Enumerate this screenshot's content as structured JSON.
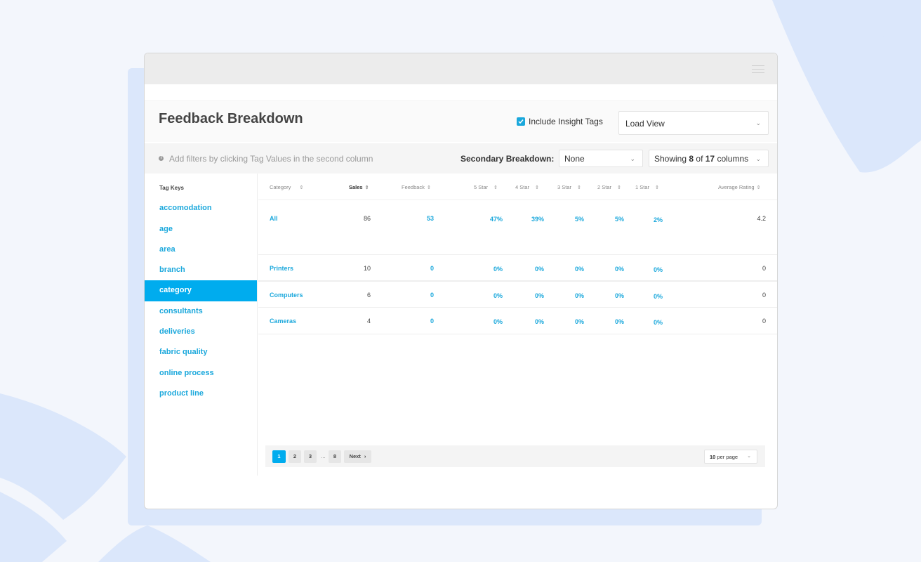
{
  "header": {
    "title": "Feedback Breakdown",
    "include_insight_label": "Include Insight Tags",
    "include_insight_checked": true,
    "load_view": "Load View"
  },
  "filters": {
    "hint": "Add filters by clicking Tag Values in the second column",
    "secondary_label": "Secondary Breakdown:",
    "secondary_value": "None",
    "showing_prefix": "Showing ",
    "showing_count": "8",
    "showing_mid": " of ",
    "showing_total": "17",
    "showing_suffix": " columns"
  },
  "sidebar": {
    "title": "Tag Keys",
    "items": [
      {
        "label": "accomodation"
      },
      {
        "label": "age"
      },
      {
        "label": "area"
      },
      {
        "label": "branch"
      },
      {
        "label": "category"
      },
      {
        "label": "consultants"
      },
      {
        "label": "deliveries"
      },
      {
        "label": "fabric quality"
      },
      {
        "label": "online process"
      },
      {
        "label": "product line"
      }
    ],
    "active_item": "category"
  },
  "table": {
    "columns": [
      "Category",
      "Sales",
      "Feedback",
      "5 Star",
      "4 Star",
      "3 Star",
      "2 Star",
      "1 Star",
      "Average Rating"
    ],
    "rows": [
      [
        "All",
        "86",
        "53",
        "47%",
        "39%",
        "5%",
        "5%",
        "2%",
        "4.2"
      ],
      [
        "Printers",
        "10",
        "0",
        "0%",
        "0%",
        "0%",
        "0%",
        "0%",
        "0"
      ],
      [
        "Computers",
        "6",
        "0",
        "0%",
        "0%",
        "0%",
        "0%",
        "0%",
        "0"
      ],
      [
        "Cameras",
        "4",
        "0",
        "0%",
        "0%",
        "0%",
        "0%",
        "0%",
        "0"
      ]
    ]
  },
  "pagination": {
    "pages": [
      "1",
      "2",
      "3",
      "8"
    ],
    "ellipsis": "...",
    "current": "1",
    "next": "Next",
    "per_page_value": "10",
    "per_page_suffix": " per page"
  },
  "colors": {
    "accent": "#00acee",
    "link": "#1ba8dc",
    "background": "#f3f6fc",
    "decoration": "#dbe7fb"
  }
}
